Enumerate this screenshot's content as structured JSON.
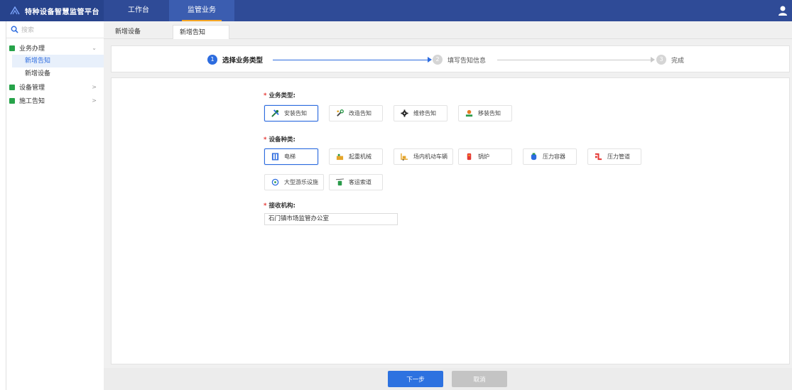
{
  "app": {
    "title": "特种设备智慧监管平台"
  },
  "top_nav": [
    {
      "label": "工作台"
    },
    {
      "label": "监管业务",
      "active": true
    }
  ],
  "sidebar": {
    "search_placeholder": "搜索",
    "menu": [
      {
        "label": "业务办理",
        "expanded": true,
        "children": [
          {
            "label": "新增告知",
            "active": true
          },
          {
            "label": "新增设备"
          }
        ]
      },
      {
        "label": "设备管理"
      },
      {
        "label": "施工告知"
      }
    ]
  },
  "tabs": [
    {
      "label": "新增设备"
    },
    {
      "label": "新增告知",
      "active": true
    }
  ],
  "steps": [
    {
      "num": "1",
      "label": "选择业务类型",
      "state": "active"
    },
    {
      "num": "2",
      "label": "填写告知信息",
      "state": "pending"
    },
    {
      "num": "3",
      "label": "完成",
      "state": "pending"
    }
  ],
  "form": {
    "business_type": {
      "required_mark": "*",
      "label": "业务类型:",
      "options": [
        {
          "label": "安装告知",
          "icon": "tools-icon",
          "selected": true
        },
        {
          "label": "改造告知",
          "icon": "wrench-icon"
        },
        {
          "label": "维修告知",
          "icon": "gear-icon"
        },
        {
          "label": "移装告知",
          "icon": "relocate-icon"
        }
      ]
    },
    "equipment_type": {
      "required_mark": "*",
      "label": "设备种类:",
      "options": [
        {
          "label": "电梯",
          "icon": "elevator-icon",
          "selected": true
        },
        {
          "label": "起重机械",
          "icon": "crane-icon"
        },
        {
          "label": "场内机动车辆",
          "icon": "forklift-icon"
        },
        {
          "label": "锅炉",
          "icon": "boiler-icon"
        },
        {
          "label": "压力容器",
          "icon": "pressure-vessel-icon"
        },
        {
          "label": "压力管道",
          "icon": "pressure-pipe-icon"
        },
        {
          "label": "大型游乐设施",
          "icon": "amusement-icon"
        },
        {
          "label": "客运索道",
          "icon": "ropeway-icon"
        }
      ]
    },
    "receiver": {
      "required_mark": "*",
      "label": "接收机构:",
      "value": "石门镇市场监管办公室"
    }
  },
  "footer": {
    "next_label": "下一步",
    "cancel_label": "取消"
  },
  "colors": {
    "topbar": "#2f4b97",
    "accent": "#2d6cdf",
    "menu_icon": "#27a34a",
    "required": "#e53935"
  }
}
